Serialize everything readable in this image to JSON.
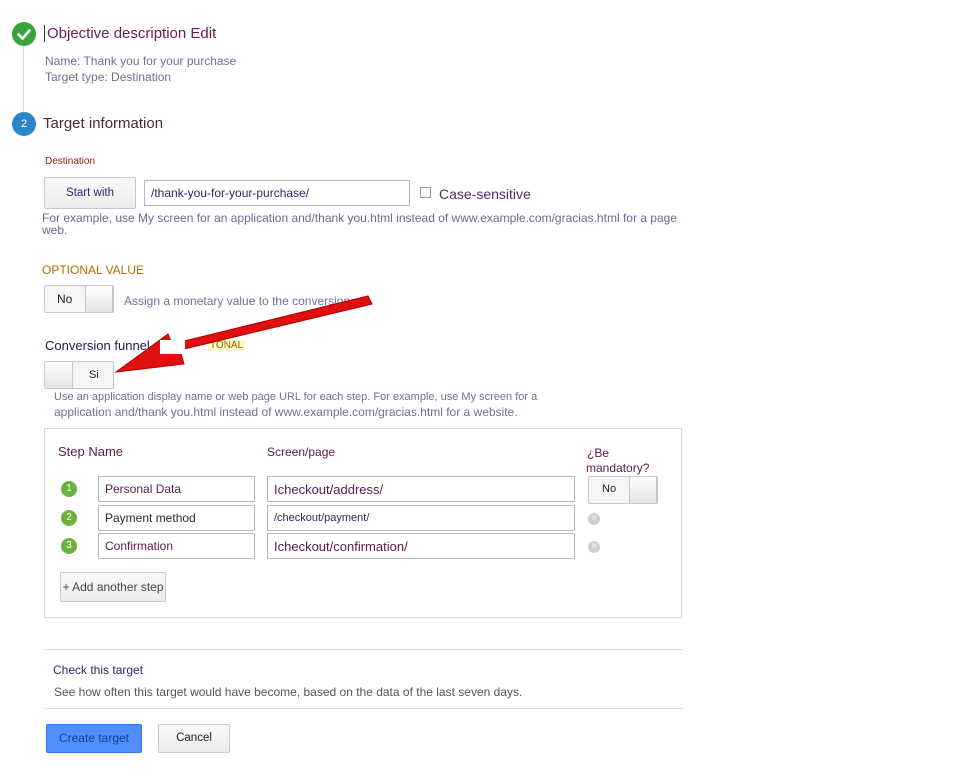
{
  "objective": {
    "title": "Objective description",
    "edit_link": "Edit",
    "name_line": "Name: Thank you for your purchase",
    "type_line": "Target type: Destination"
  },
  "target": {
    "step_number": "2",
    "title": "Target information",
    "destination_label": "Destination",
    "match_button": "Start with",
    "destination_value": "/thank-you-for-your-purchase/",
    "case_sensitive_label": "Case-sensitive",
    "example_line1": "For example, use My screen for an application and/thank you.html instead of www.example.com/gracias.html for a page",
    "example_line2": "web."
  },
  "value": {
    "label": "OPTIONAL VALUE",
    "toggle_label": "No",
    "description": "Assign a monetary value to the conversion"
  },
  "funnel": {
    "label": "Conversion funnel",
    "optional_tag": "TONAL",
    "toggle_label": "Si",
    "help_line1": "Use an application display name or web page URL for each step. For example, use My screen for a",
    "help_line2": "application and/thank you.html instead of www.example.com/gracias.html for a website.",
    "col_step_name": "Step Name",
    "col_screen": "Screen/page",
    "col_mandatory_line1": "¿Be",
    "col_mandatory_line2": "mandatory?",
    "mandatory_toggle": "No",
    "steps": [
      {
        "num": "1",
        "name": "Personal Data",
        "screen": "Icheckout/address/"
      },
      {
        "num": "2",
        "name": "Payment method",
        "screen": "/checkout/payment/"
      },
      {
        "num": "3",
        "name": "Confirmation",
        "screen": "Icheckout/confirmation/"
      }
    ],
    "add_step_button": "+ Add another step"
  },
  "check": {
    "link": "Check this target",
    "description": "See how often this target would have become, based on the data of the last seven days."
  },
  "actions": {
    "create": "Create target",
    "cancel": "Cancel"
  },
  "colors": {
    "primary_button": "#4d90fe",
    "annotation_arrow": "#e01010"
  }
}
